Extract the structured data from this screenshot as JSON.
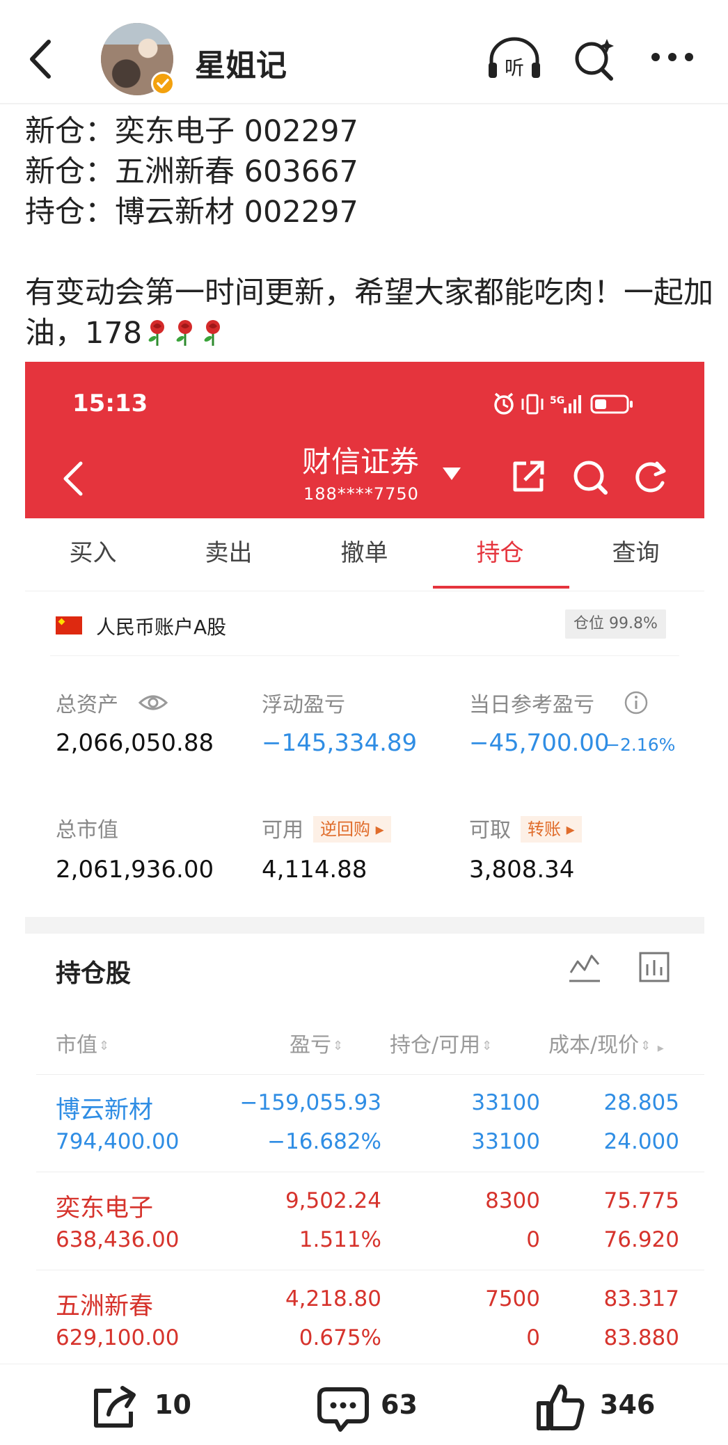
{
  "header": {
    "user_name": "星姐记",
    "icons": [
      "back-arrow-icon",
      "avatar",
      "verified-badge-icon",
      "headphones-listen-icon",
      "search-sparkle-icon",
      "more-dots-icon"
    ],
    "listen_label": "听"
  },
  "post": {
    "lines": [
      "新仓：奕东电子 002297",
      "新仓：五洲新春 603667",
      "持仓：博云新材 002297"
    ],
    "paragraph": "有变动会第一时间更新，希望大家都能吃肉！一起加油，178",
    "emoji": "rose"
  },
  "screenshot": {
    "status_time": "15:13",
    "status_network": "5G",
    "broker_name": "财信证券",
    "account_masked": "188****7750",
    "tabs": [
      {
        "label": "买入",
        "active": false
      },
      {
        "label": "卖出",
        "active": false
      },
      {
        "label": "撤单",
        "active": false
      },
      {
        "label": "持仓",
        "active": true
      },
      {
        "label": "查询",
        "active": false
      }
    ],
    "account": {
      "type_label": "人民币账户A股",
      "position_ratio": "仓位 99.8%",
      "total_assets_label": "总资产",
      "total_assets": "2,066,050.88",
      "floating_pl_label": "浮动盈亏",
      "floating_pl": "−145,334.89",
      "daily_pl_label": "当日参考盈亏",
      "daily_pl": "−45,700.00",
      "daily_pl_pct": "−2.16%",
      "market_value_label": "总市值",
      "market_value": "2,061,936.00",
      "available_label": "可用",
      "reverse_repo_label": "逆回购",
      "available": "4,114.88",
      "withdrawable_label": "可取",
      "transfer_label": "转账",
      "withdrawable": "3,808.34"
    },
    "holdings": {
      "title": "持仓股",
      "columns": [
        "市值",
        "盈亏",
        "持仓/可用",
        "成本/现价"
      ],
      "sort_glyph": "⇕",
      "rows": [
        {
          "name": "博云新材",
          "market_value": "794,400.00",
          "pl": "−159,055.93",
          "pl_pct": "−16.682%",
          "shares": "33100",
          "available": "33100",
          "cost": "28.805",
          "price": "24.000",
          "trend": "down"
        },
        {
          "name": "奕东电子",
          "market_value": "638,436.00",
          "pl": "9,502.24",
          "pl_pct": "1.511%",
          "shares": "8300",
          "available": "0",
          "cost": "75.775",
          "price": "76.920",
          "trend": "up"
        },
        {
          "name": "五洲新春",
          "market_value": "629,100.00",
          "pl": "4,218.80",
          "pl_pct": "0.675%",
          "shares": "7500",
          "available": "0",
          "cost": "83.317",
          "price": "83.880",
          "trend": "up"
        }
      ]
    }
  },
  "footer": {
    "share_count": "10",
    "comment_count": "63",
    "like_count": "346"
  },
  "colors": {
    "brand_red": "#e5343d",
    "loss_blue": "#2f8de4",
    "gain_red": "#d6332c",
    "pill_orange": "#e06c2b",
    "verified_gold": "#f3a10e"
  }
}
